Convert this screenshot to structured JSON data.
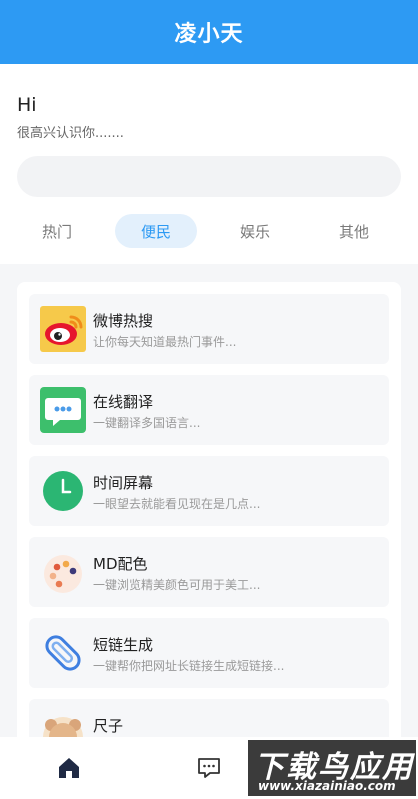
{
  "app": {
    "title": "凌小天"
  },
  "greeting": {
    "title": "Hi",
    "subtitle": "很高兴认识你......."
  },
  "search": {
    "placeholder": ""
  },
  "tabs": [
    {
      "label": "热门"
    },
    {
      "label": "便民",
      "active": true
    },
    {
      "label": "娱乐"
    },
    {
      "label": "其他"
    }
  ],
  "items": [
    {
      "name": "微博热搜",
      "desc": "让你每天知道最热门事件...",
      "icon": "weibo-icon"
    },
    {
      "name": "在线翻译",
      "desc": "一键翻译多国语言...",
      "icon": "translate-chat-icon"
    },
    {
      "name": "时间屏幕",
      "desc": "一眼望去就能看见现在是几点...",
      "icon": "clock-icon"
    },
    {
      "name": "MD配色",
      "desc": "一键浏览精美颜色可用于美工...",
      "icon": "palette-icon"
    },
    {
      "name": "短链生成",
      "desc": "一键帮你把网址长链接生成短链接...",
      "icon": "paperclip-icon"
    },
    {
      "name": "尺子",
      "desc": "",
      "icon": "bear-icon"
    }
  ],
  "nav": {
    "items": [
      {
        "icon": "home-icon",
        "active": true
      },
      {
        "icon": "message-icon"
      }
    ]
  },
  "watermark": {
    "main": "下载鸟应用",
    "sub": "www.xiazainiao.com"
  },
  "colors": {
    "accent": "#2d9af3",
    "tab_active_bg": "#e3f0fc"
  }
}
